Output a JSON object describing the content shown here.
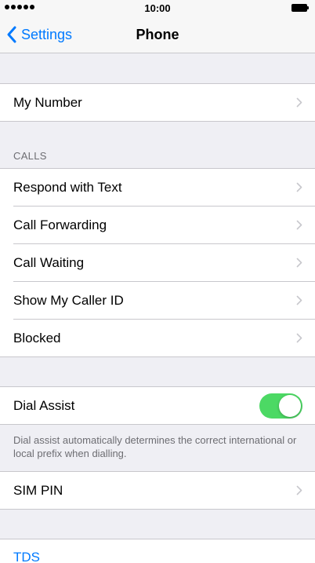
{
  "status_bar": {
    "time": "10:00",
    "icons": [
      "signal-dots-icon",
      "battery-icon"
    ]
  },
  "nav": {
    "back_label": "Settings",
    "title": "Phone"
  },
  "group_my_number": {
    "items": [
      {
        "label": "My Number"
      }
    ]
  },
  "calls": {
    "header": "CALLS",
    "items": [
      {
        "label": "Respond with Text"
      },
      {
        "label": "Call Forwarding"
      },
      {
        "label": "Call Waiting"
      },
      {
        "label": "Show My Caller ID"
      },
      {
        "label": "Blocked"
      }
    ]
  },
  "dial_assist": {
    "label": "Dial Assist",
    "enabled": true,
    "description": "Dial assist automatically determines the correct international or local prefix when dialling."
  },
  "sim": {
    "label": "SIM PIN"
  },
  "partial": {
    "label": "TDS"
  },
  "colors": {
    "accent": "#007aff",
    "toggle_on": "#4cd964",
    "background": "#efeff4",
    "separator": "#c8c7cc"
  }
}
